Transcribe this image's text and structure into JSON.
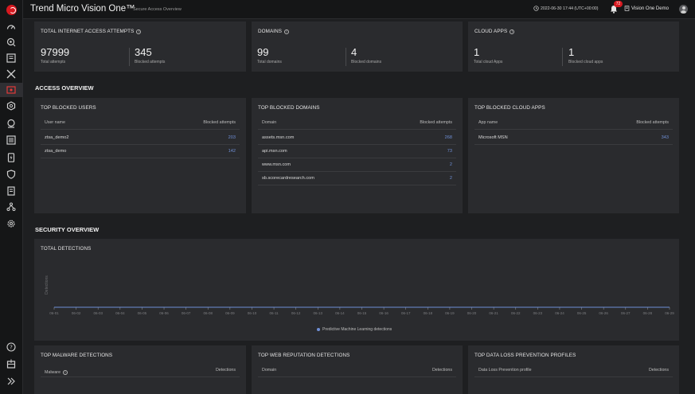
{
  "header": {
    "app_title": "Trend Micro Vision One™",
    "page_subtitle": "Secure Access Overview",
    "datetime": "2022-06-30 17:44 (UTC+00:00)",
    "notification_count": "72",
    "account_name": "Vision One Demo"
  },
  "sidebar": {
    "icons": [
      "logo-icon",
      "dashboard-icon",
      "search-icon",
      "workbench-icon",
      "xdr-icon",
      "secure-access-icon",
      "settings-gear-icon",
      "threat-hunt-icon",
      "list-icon",
      "phone-icon",
      "shield-icon",
      "report-icon",
      "network-icon",
      "gear-icon",
      "help-icon",
      "inbox-icon",
      "expand-icon"
    ]
  },
  "summary": {
    "internet": {
      "title": "TOTAL INTERNET ACCESS ATTEMPTS",
      "total_value": "97999",
      "total_label": "Total attempts",
      "blocked_value": "345",
      "blocked_label": "Blocked attempts"
    },
    "domains": {
      "title": "DOMAINS",
      "total_value": "99",
      "total_label": "Total domains",
      "blocked_value": "4",
      "blocked_label": "Blocked domains"
    },
    "cloud_apps": {
      "title": "CLOUD APPS",
      "total_value": "1",
      "total_label": "Total cloud Apps",
      "blocked_value": "1",
      "blocked_label": "Blocked cloud apps"
    }
  },
  "access_overview": {
    "heading": "ACCESS OVERVIEW",
    "users": {
      "title": "TOP BLOCKED USERS",
      "col1": "User name",
      "col2": "Blocked attempts",
      "rows": [
        {
          "name": "ztsa_demo2",
          "value": "203"
        },
        {
          "name": "ztsa_demo",
          "value": "142"
        }
      ]
    },
    "domains": {
      "title": "TOP BLOCKED DOMAINS",
      "col1": "Domain",
      "col2": "Blocked attempts",
      "rows": [
        {
          "name": "assets.msn.com",
          "value": "268"
        },
        {
          "name": "api.msn.com",
          "value": "73"
        },
        {
          "name": "www.msn.com",
          "value": "2"
        },
        {
          "name": "sb.scorecardresearch.com",
          "value": "2"
        }
      ]
    },
    "apps": {
      "title": "TOP BLOCKED CLOUD APPS",
      "col1": "App name",
      "col2": "Blocked attempts",
      "rows": [
        {
          "name": "Microsoft MSN",
          "value": "343"
        }
      ]
    }
  },
  "security_overview": {
    "heading": "SECURITY OVERVIEW",
    "detections_title": "TOTAL DETECTIONS",
    "malware": {
      "title": "TOP MALWARE DETECTIONS",
      "col1": "Malware",
      "col2": "Detections"
    },
    "web_reputation": {
      "title": "TOP WEB REPUTATION DETECTIONS",
      "col1": "Domain",
      "col2": "Detections"
    },
    "dlp": {
      "title": "TOP DATA LOSS PREVENTION PROFILES",
      "col1": "Data Loss Prevention profile",
      "col2": "Detections"
    }
  },
  "chart_data": {
    "type": "line",
    "title": "TOTAL DETECTIONS",
    "ylabel": "Detections",
    "x": [
      "06-01",
      "06-02",
      "06-03",
      "06-04",
      "06-05",
      "06-06",
      "06-07",
      "06-08",
      "06-09",
      "06-10",
      "06-11",
      "06-12",
      "06-13",
      "06-14",
      "06-15",
      "06-16",
      "06-17",
      "06-18",
      "06-19",
      "06-20",
      "06-21",
      "06-22",
      "06-23",
      "06-24",
      "06-25",
      "06-26",
      "06-27",
      "06-28",
      "06-29"
    ],
    "series": [
      {
        "name": "Predictive Machine Learning detections",
        "values": [
          0,
          0,
          0,
          0,
          0,
          0,
          0,
          0,
          0,
          0,
          0,
          0,
          0,
          0,
          0,
          0,
          0,
          0,
          0,
          0,
          0,
          0,
          0,
          0,
          0,
          0,
          0,
          0,
          0
        ]
      }
    ],
    "grid": false,
    "legend": "bottom-center",
    "series_color": "#6f8fd6"
  }
}
